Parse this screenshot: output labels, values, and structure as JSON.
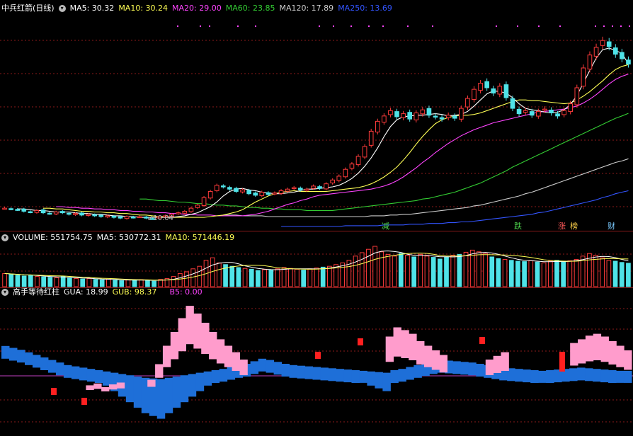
{
  "price_header": {
    "title": "中兵红箭(日线)",
    "ma5": "MA5: 30.32",
    "ma10": "MA10: 30.24",
    "ma20": "MA20: 29.00",
    "ma60": "MA60: 23.85",
    "ma120": "MA120: 17.89",
    "ma250": "MA250: 13.69"
  },
  "volume_header": {
    "title": "VOLUME: 551754.75",
    "ma5": "MA5: 530772.31",
    "ma10": "MA10: 571446.19"
  },
  "indicator_header": {
    "title": "高手等待红柱",
    "gua": "GUA: 18.99",
    "gub": "GUB: 98.37",
    "b5": "B5: 0.00"
  },
  "low_label": "10.04",
  "signals": [
    {
      "text": "减",
      "color": "#4cd24c"
    },
    {
      "text": "跌",
      "color": "#4cd24c"
    },
    {
      "text": "涨",
      "color": "#ff5a5a"
    },
    {
      "text": "榜",
      "color": "#ffd24a"
    },
    {
      "text": "财",
      "color": "#79c9ff"
    }
  ],
  "colors": {
    "up": "#ff3b3b",
    "down": "#4fe3e8",
    "ma5": "#ffffff",
    "ma10": "#ffff55",
    "ma20": "#ff44ff",
    "ma60": "#33cc33",
    "ma120": "#cccccc",
    "ma250": "#3355ff",
    "gua": "#1e6fd8",
    "gub": "#ff9ccc",
    "b5": "#ff2020",
    "grid": "#8b1a1a"
  },
  "chart_data": {
    "type": "candlestick",
    "title": "中兵红箭(日线)",
    "panels": [
      "price",
      "volume",
      "indicator"
    ],
    "price": {
      "close": [
        11.4,
        11.3,
        11.2,
        11.0,
        10.9,
        11.1,
        10.8,
        10.7,
        10.9,
        10.8,
        10.6,
        10.7,
        10.5,
        10.6,
        10.4,
        10.3,
        10.4,
        10.2,
        10.1,
        10.3,
        10.2,
        10.3,
        10.1,
        10.04,
        10.3,
        10.4,
        10.6,
        10.8,
        11.0,
        11.4,
        11.8,
        12.8,
        13.6,
        14.4,
        14.2,
        13.9,
        13.6,
        13.8,
        13.3,
        13.1,
        13.5,
        13.2,
        13.4,
        13.7,
        13.9,
        14.1,
        13.8,
        13.9,
        14.3,
        14.0,
        14.6,
        15.1,
        15.6,
        16.5,
        17.2,
        18.2,
        19.5,
        21.5,
        22.8,
        23.5,
        24.2,
        23.4,
        23.8,
        23.1,
        23.9,
        24.3,
        23.6,
        23.4,
        23.1,
        23.6,
        23.2,
        24.5,
        25.8,
        27.0,
        27.8,
        27.2,
        26.5,
        27.4,
        25.9,
        24.5,
        23.8,
        24.2,
        23.6,
        24.1,
        24.4,
        23.9,
        23.5,
        24.2,
        25.1,
        27.2,
        29.8,
        31.5,
        32.5,
        33.4,
        32.6,
        31.6,
        31.0,
        30.3
      ],
      "ma5": [
        11.3,
        11.3,
        11.2,
        11.1,
        11.1,
        11.0,
        10.9,
        10.9,
        10.9,
        10.8,
        10.7,
        10.7,
        10.6,
        10.6,
        10.5,
        10.4,
        10.4,
        10.3,
        10.3,
        10.2,
        10.2,
        10.2,
        10.2,
        10.2,
        10.2,
        10.3,
        10.4,
        10.6,
        10.8,
        11.2,
        11.6,
        12.2,
        13.0,
        13.6,
        13.9,
        14.0,
        13.8,
        13.7,
        13.5,
        13.4,
        13.3,
        13.3,
        13.4,
        13.5,
        13.7,
        13.9,
        13.9,
        14.0,
        14.1,
        14.2,
        14.4,
        14.8,
        15.3,
        16.0,
        16.9,
        18.0,
        19.3,
        20.8,
        22.1,
        23.0,
        23.4,
        23.5,
        23.6,
        23.6,
        23.7,
        23.8,
        23.7,
        23.5,
        23.6,
        23.7,
        24.1,
        24.8,
        25.6,
        26.4,
        26.8,
        26.7,
        26.5,
        25.9,
        25.1,
        24.5,
        24.3,
        24.2,
        24.0,
        23.9,
        24.0,
        24.3,
        25.0,
        26.2,
        27.8,
        29.5,
        31.1,
        32.2,
        32.4,
        32.1,
        31.7,
        30.32
      ],
      "ma10": [
        11.4,
        11.4,
        11.3,
        11.3,
        11.2,
        11.1,
        11.0,
        11.0,
        10.9,
        10.9,
        10.8,
        10.8,
        10.7,
        10.7,
        10.6,
        10.5,
        10.5,
        10.4,
        10.3,
        10.3,
        10.2,
        10.2,
        10.2,
        10.2,
        10.2,
        10.2,
        10.3,
        10.4,
        10.5,
        10.7,
        10.9,
        11.2,
        11.7,
        12.2,
        12.6,
        13.0,
        13.3,
        13.5,
        13.6,
        13.7,
        13.6,
        13.6,
        13.6,
        13.6,
        13.6,
        13.7,
        13.8,
        13.9,
        14.0,
        14.1,
        14.3,
        14.6,
        15.0,
        15.5,
        16.1,
        16.8,
        17.7,
        18.7,
        19.8,
        20.8,
        21.7,
        22.5,
        23.0,
        23.3,
        23.5,
        23.6,
        23.6,
        23.7,
        23.9,
        24.2,
        24.5,
        24.8,
        25.1,
        25.4,
        25.6,
        25.6,
        25.5,
        25.5,
        25.4,
        25.3,
        25.2,
        25.1,
        25.2,
        25.6,
        26.1,
        26.7,
        27.4,
        28.1,
        28.9,
        29.6,
        30.0,
        30.24
      ],
      "ma20": [
        11.6,
        11.6,
        11.5,
        11.5,
        11.4,
        11.4,
        11.3,
        11.3,
        11.2,
        11.2,
        11.1,
        11.1,
        11.0,
        11.0,
        10.9,
        10.9,
        10.8,
        10.8,
        10.7,
        10.7,
        10.6,
        10.6,
        10.5,
        10.5,
        10.5,
        10.4,
        10.4,
        10.4,
        10.4,
        10.4,
        10.5,
        10.6,
        10.8,
        11.0,
        11.3,
        11.6,
        11.9,
        12.1,
        12.4,
        12.6,
        12.9,
        13.1,
        13.2,
        13.3,
        13.4,
        13.5,
        13.6,
        13.7,
        13.8,
        13.9,
        14.1,
        14.3,
        14.6,
        15.0,
        15.5,
        16.1,
        16.7,
        17.4,
        18.0,
        18.7,
        19.3,
        19.9,
        20.4,
        20.9,
        21.3,
        21.7,
        22.0,
        22.3,
        22.6,
        22.8,
        23.0,
        23.2,
        23.4,
        23.6,
        23.8,
        24.0,
        24.1,
        24.2,
        24.3,
        24.4,
        24.6,
        24.8,
        25.2,
        25.7,
        26.3,
        27.0,
        27.7,
        28.3,
        28.7,
        29.0
      ],
      "ma60": [
        12.6,
        12.6,
        12.5,
        12.4,
        12.4,
        12.3,
        12.2,
        12.2,
        12.1,
        12.0,
        12.0,
        11.9,
        11.8,
        11.8,
        11.7,
        11.7,
        11.6,
        11.5,
        11.5,
        11.4,
        11.4,
        11.3,
        11.3,
        11.2,
        11.2,
        11.2,
        11.1,
        11.1,
        11.1,
        11.1,
        11.1,
        11.2,
        11.3,
        11.4,
        11.5,
        11.6,
        11.7,
        11.8,
        11.9,
        12.0,
        12.1,
        12.2,
        12.3,
        12.4,
        12.6,
        12.7,
        12.9,
        13.1,
        13.3,
        13.5,
        13.8,
        14.1,
        14.4,
        14.7,
        15.1,
        15.5,
        15.9,
        16.3,
        16.8,
        17.2,
        17.6,
        18.0,
        18.4,
        18.8,
        19.2,
        19.6,
        20.0,
        20.4,
        20.8,
        21.2,
        21.6,
        22.0,
        22.4,
        22.8,
        23.2,
        23.5,
        23.85
      ],
      "ma120": [
        10.5,
        10.5,
        10.5,
        10.4,
        10.4,
        10.4,
        10.4,
        10.3,
        10.3,
        10.3,
        10.3,
        10.3,
        10.3,
        10.3,
        10.3,
        10.3,
        10.3,
        10.3,
        10.3,
        10.3,
        10.3,
        10.3,
        10.3,
        10.4,
        10.4,
        10.4,
        10.5,
        10.5,
        10.6,
        10.6,
        10.7,
        10.8,
        10.9,
        11.0,
        11.1,
        11.2,
        11.3,
        11.4,
        11.5,
        11.7,
        11.8,
        12.0,
        12.2,
        12.4,
        12.6,
        12.8,
        13.0,
        13.3,
        13.5,
        13.8,
        14.1,
        14.4,
        14.7,
        15.0,
        15.3,
        15.6,
        15.9,
        16.2,
        16.5,
        16.8,
        17.1,
        17.4,
        17.6,
        17.89
      ],
      "ma250": [
        9.0,
        9.0,
        9.0,
        9.0,
        9.0,
        9.0,
        9.0,
        9.0,
        9.0,
        9.0,
        9.1,
        9.1,
        9.1,
        9.1,
        9.1,
        9.1,
        9.2,
        9.2,
        9.2,
        9.2,
        9.3,
        9.3,
        9.3,
        9.4,
        9.4,
        9.4,
        9.5,
        9.5,
        9.6,
        9.6,
        9.7,
        9.8,
        9.9,
        10.0,
        10.1,
        10.2,
        10.3,
        10.4,
        10.5,
        10.6,
        10.8,
        10.9,
        11.1,
        11.3,
        11.5,
        11.7,
        11.9,
        12.1,
        12.3,
        12.5,
        12.8,
        13.0,
        13.3,
        13.5,
        13.69
      ]
    },
    "volume": {
      "series": [
        "VOLUME",
        "MA5",
        "MA10"
      ],
      "values": [
        310,
        290,
        270,
        250,
        260,
        240,
        230,
        220,
        210,
        240,
        200,
        190,
        180,
        190,
        170,
        160,
        175,
        150,
        140,
        160,
        150,
        165,
        140,
        130,
        170,
        190,
        240,
        310,
        350,
        420,
        480,
        620,
        680,
        560,
        520,
        480,
        450,
        430,
        410,
        380,
        400,
        390,
        420,
        450,
        430,
        410,
        390,
        420,
        440,
        460,
        480,
        520,
        560,
        620,
        720,
        800,
        880,
        950,
        820,
        760,
        720,
        780,
        740,
        700,
        760,
        720,
        690,
        650,
        700,
        740,
        760,
        810,
        860,
        820,
        780,
        700,
        660,
        640,
        620,
        600,
        590,
        610,
        580,
        560,
        600,
        620,
        590,
        610,
        640,
        720,
        780,
        740,
        680,
        620,
        600,
        570,
        551.75
      ]
    },
    "indicator": {
      "series": [
        "GUA",
        "GUB",
        "B5"
      ],
      "gua": [
        58,
        55,
        52,
        48,
        44,
        40,
        36,
        32,
        28,
        26,
        24,
        22,
        20,
        18,
        16,
        14,
        12,
        10,
        8,
        7,
        6,
        8,
        10,
        12,
        14,
        16,
        18,
        20,
        22,
        25,
        28,
        30,
        34,
        38,
        36,
        33,
        30,
        28,
        27,
        26,
        25,
        24,
        23,
        22,
        21,
        20,
        19,
        18,
        17,
        16,
        20,
        22,
        25,
        28,
        31,
        34,
        36,
        35,
        34,
        33,
        32,
        30,
        28,
        26,
        24,
        23,
        22,
        21,
        20,
        19,
        20,
        21,
        22,
        23,
        24,
        23,
        22,
        21,
        20,
        19,
        18.99
      ],
      "gub": [
        0,
        0,
        0,
        0,
        0,
        0,
        0,
        0,
        0,
        0,
        0,
        12,
        14,
        10,
        13,
        15,
        0,
        0,
        0,
        18,
        35,
        55,
        70,
        85,
        98.37,
        90,
        80,
        70,
        62,
        55,
        48,
        40,
        0,
        0,
        0,
        0,
        0,
        0,
        0,
        0,
        0,
        0,
        0,
        0,
        0,
        0,
        0,
        0,
        0,
        0,
        65,
        75,
        72,
        68,
        60,
        55,
        50,
        45,
        0,
        0,
        0,
        0,
        0,
        40,
        44,
        48,
        0,
        0,
        0,
        0,
        0,
        0,
        0,
        0,
        58,
        62,
        66,
        68,
        65,
        60,
        55,
        50
      ],
      "b5": 0.0
    },
    "signals": [
      "减",
      "跌",
      "涨",
      "榜",
      "财"
    ],
    "ylim_price": [
      9,
      35
    ]
  }
}
